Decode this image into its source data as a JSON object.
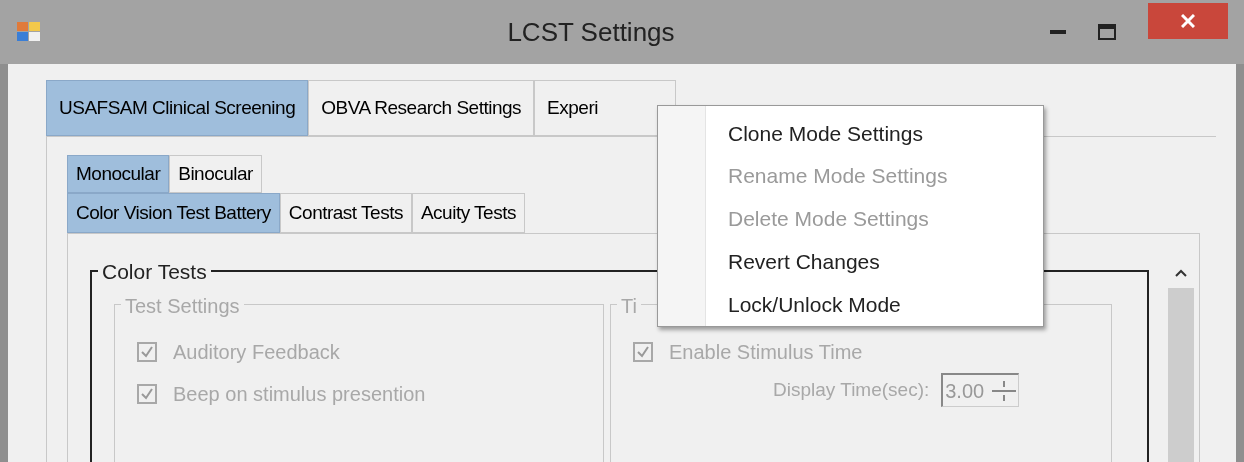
{
  "window": {
    "title": "LCST Settings"
  },
  "tabs": [
    {
      "label": "USAFSAM Clinical Screening",
      "selected": true
    },
    {
      "label": "OBVA Research Settings",
      "selected": false
    },
    {
      "label": "Experi",
      "selected": false
    }
  ],
  "eye_tabs": [
    {
      "label": "Monocular",
      "selected": true
    },
    {
      "label": "Binocular",
      "selected": false
    }
  ],
  "test_tabs": [
    {
      "label": "Color Vision Test Battery",
      "selected": true
    },
    {
      "label": "Contrast Tests",
      "selected": false
    },
    {
      "label": "Acuity Tests",
      "selected": false
    }
  ],
  "color_tests": {
    "title": "Color Tests",
    "test_settings": {
      "title": "Test Settings",
      "options": [
        {
          "label": "Auditory Feedback",
          "checked": true,
          "disabled": true
        },
        {
          "label": "Beep on stimulus presention",
          "checked": true,
          "disabled": true
        }
      ]
    },
    "timing": {
      "title": "Ti",
      "options": [
        {
          "label": "Enable Stimulus Time",
          "checked": true,
          "disabled": true
        }
      ],
      "display_time": {
        "label": "Display Time(sec):",
        "value": "3.00",
        "disabled": true
      }
    }
  },
  "context_menu": {
    "items": [
      {
        "label": "Clone Mode Settings",
        "disabled": false
      },
      {
        "label": "Rename Mode Settings",
        "disabled": true
      },
      {
        "label": "Delete Mode Settings",
        "disabled": true
      },
      {
        "label": "Revert Changes",
        "disabled": false
      },
      {
        "label": "Lock/Unlock Mode",
        "disabled": false
      }
    ]
  }
}
